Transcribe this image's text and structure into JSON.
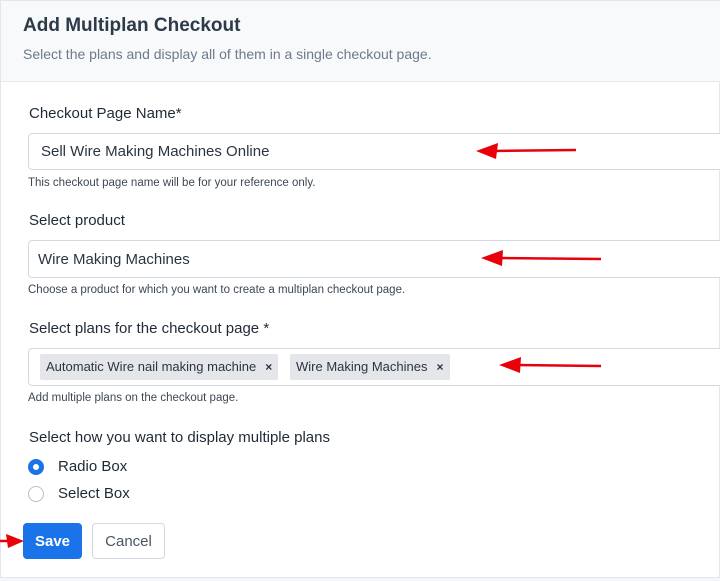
{
  "header": {
    "title": "Add Multiplan Checkout",
    "subtitle": "Select the plans and display all of them in a single checkout page."
  },
  "checkout_name": {
    "label": "Checkout Page Name*",
    "value": "Sell Wire Making Machines Online",
    "help": "This checkout page name will be for your reference only."
  },
  "product": {
    "label": "Select product",
    "value": "Wire Making Machines",
    "help": "Choose a product for which you want to create a multiplan checkout page."
  },
  "plans": {
    "label": "Select plans for the checkout page *",
    "tags": [
      {
        "label": "Automatic Wire nail making machine",
        "remove": "×"
      },
      {
        "label": "Wire Making Machines",
        "remove": "×"
      }
    ],
    "help": "Add multiple plans on the checkout page."
  },
  "display": {
    "label": "Select how you want to display multiple plans",
    "options": [
      {
        "label": "Radio Box",
        "checked": true
      },
      {
        "label": "Select Box",
        "checked": false
      }
    ]
  },
  "actions": {
    "save_label": "Save",
    "cancel_label": "Cancel"
  },
  "colors": {
    "primary": "#1a73e8",
    "annotation_arrow": "#e8000b"
  }
}
